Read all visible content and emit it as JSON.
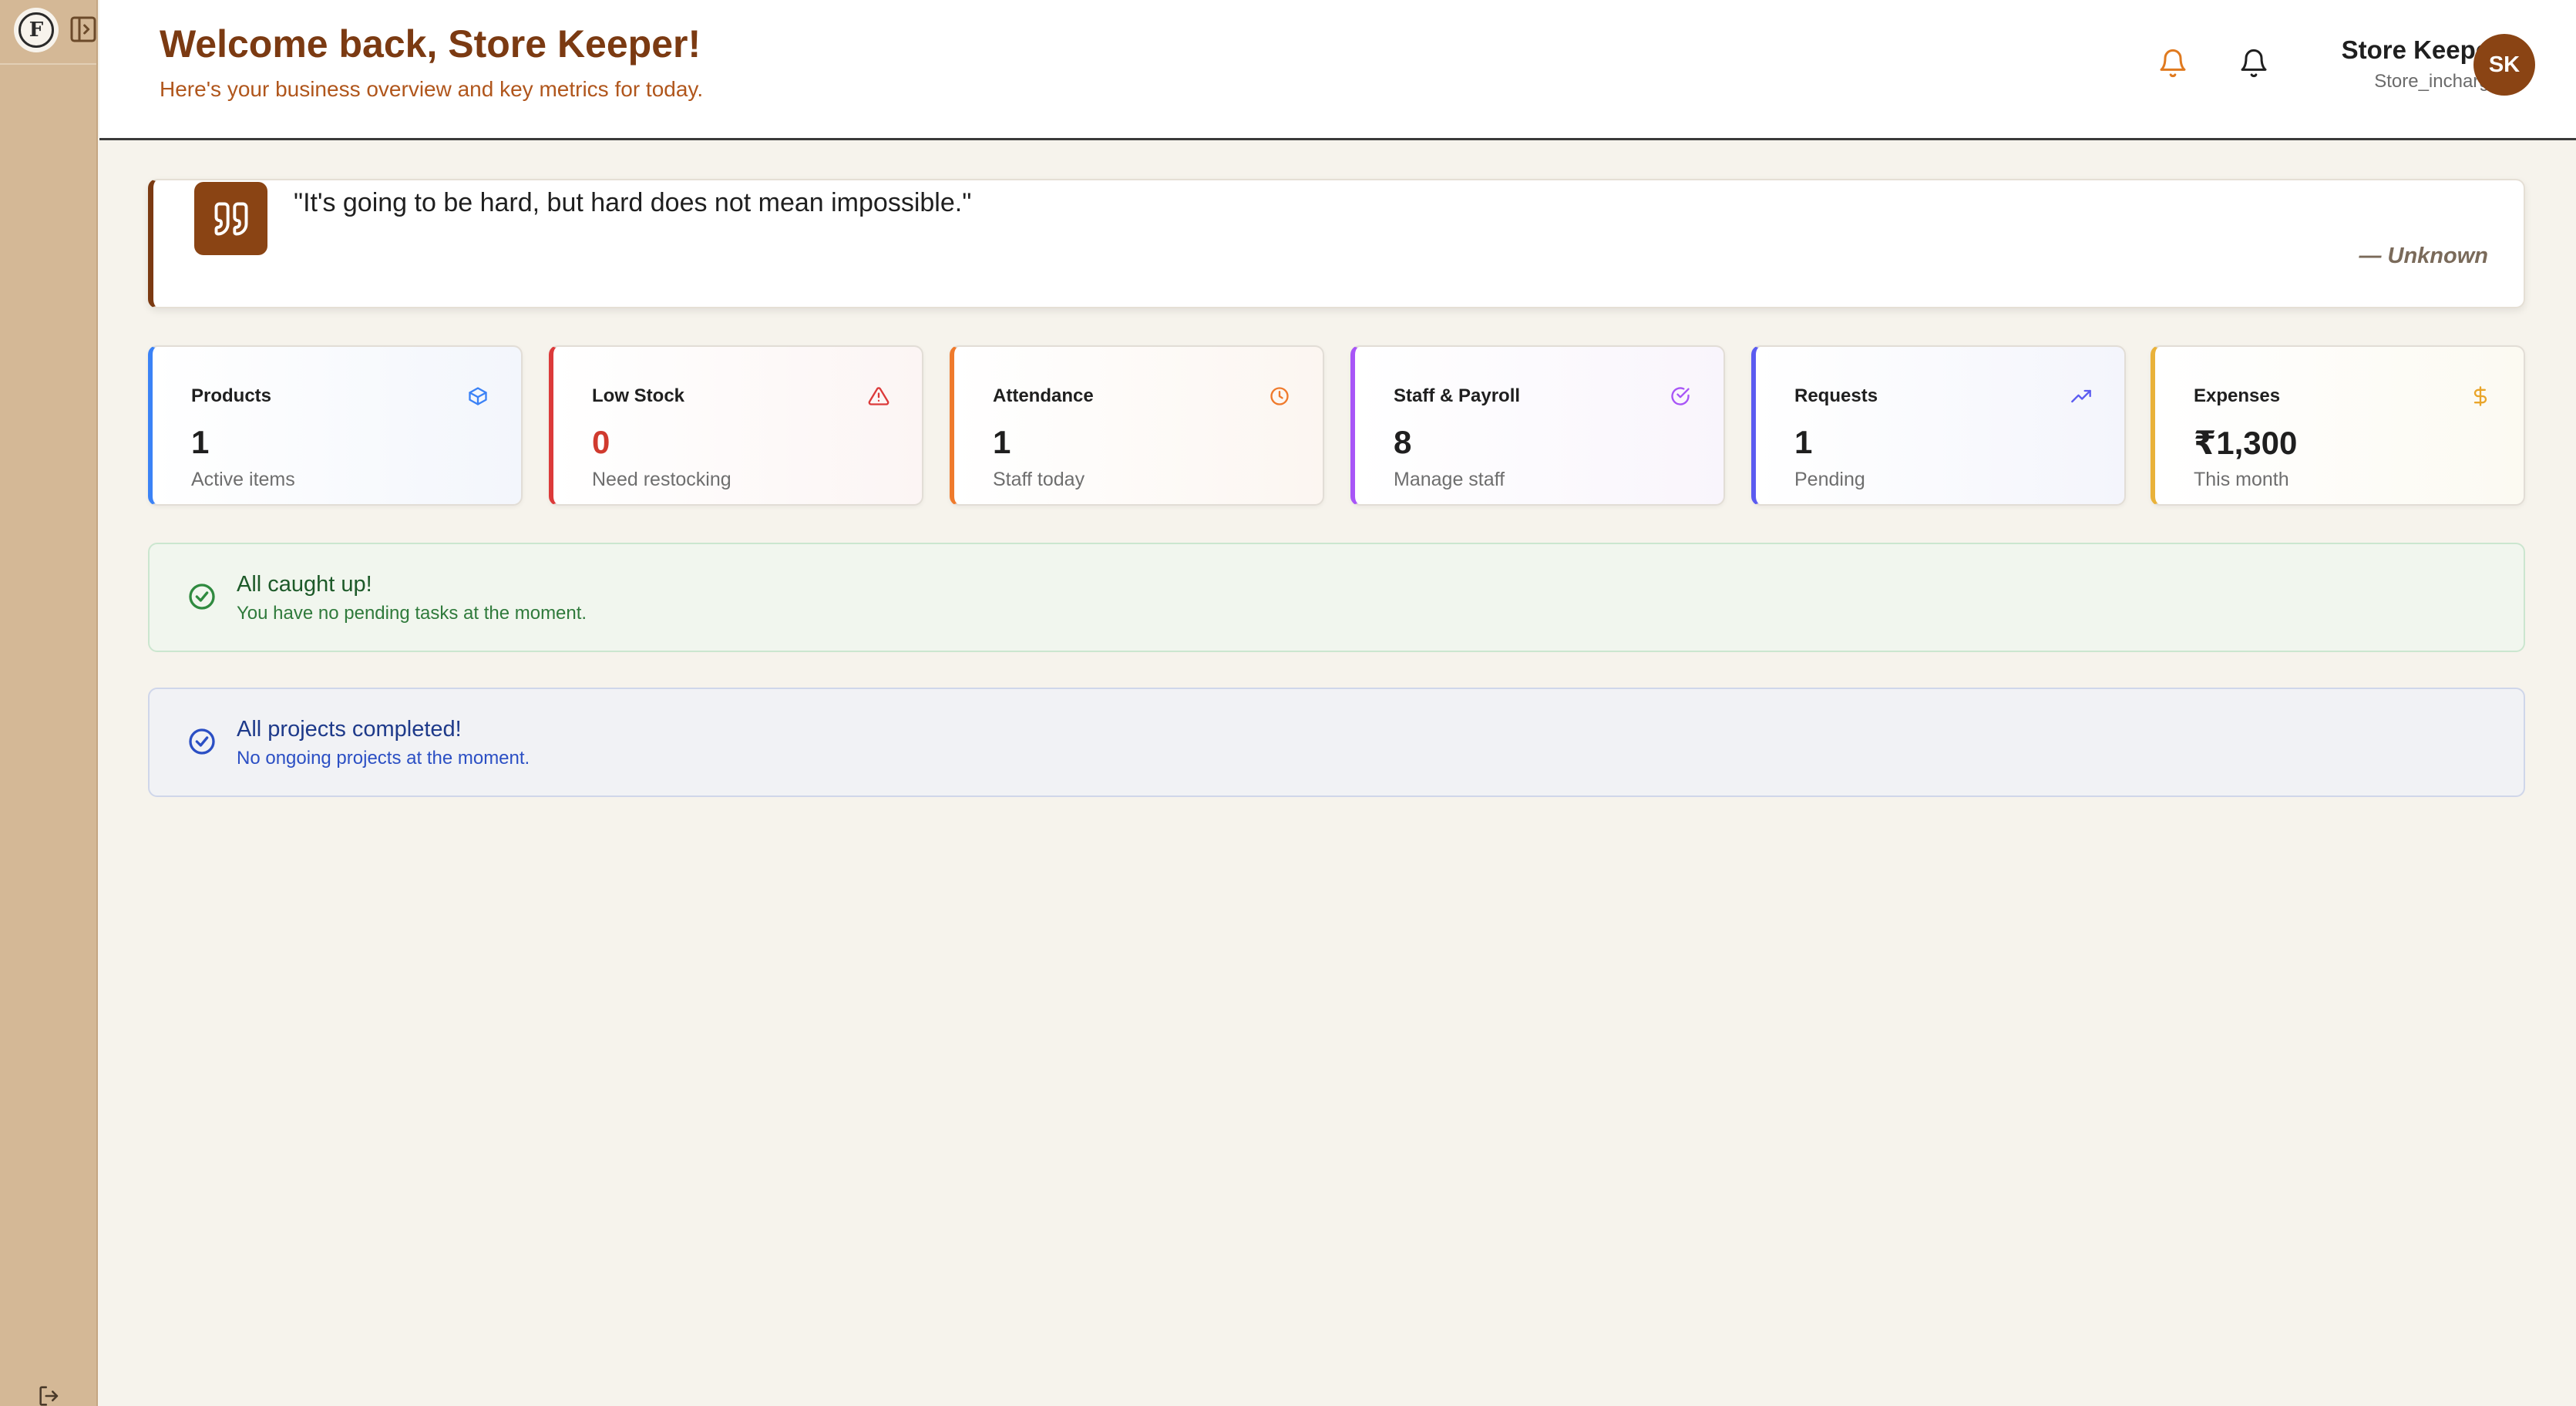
{
  "sidebar": {
    "logo_letter": "F",
    "toggle_icon": "sidebar-toggle-icon",
    "logout_icon": "logout-icon"
  },
  "header": {
    "title": "Welcome back, Store Keeper!",
    "subtitle": "Here's your business overview and key metrics for today.",
    "notification_icons": [
      "bell-icon",
      "bell-icon"
    ],
    "user": {
      "name": "Store Keeper",
      "role": "Store_incharge",
      "initials": "SK"
    }
  },
  "quote": {
    "text": "\"It's going to be hard, but hard does not mean impossible.\"",
    "author": "— Unknown",
    "icon": "quote-icon"
  },
  "stats": [
    {
      "label": "Products",
      "value": "1",
      "description": "Active items",
      "icon": "box-icon",
      "color": "#3b82f6"
    },
    {
      "label": "Low Stock",
      "value": "0",
      "description": "Need restocking",
      "icon": "warning-triangle-icon",
      "color": "#dc3a3a"
    },
    {
      "label": "Attendance",
      "value": "1",
      "description": "Staff today",
      "icon": "clock-icon",
      "color": "#ef7a2c"
    },
    {
      "label": "Staff & Payroll",
      "value": "8",
      "description": "Manage staff",
      "icon": "check-circle-icon",
      "color": "#a855f7"
    },
    {
      "label": "Requests",
      "value": "1",
      "description": "Pending",
      "icon": "trending-up-icon",
      "color": "#5b5bf0"
    },
    {
      "label": "Expenses",
      "value": "₹1,300",
      "description": "This month",
      "icon": "dollar-icon",
      "color": "#e9b23a"
    }
  ],
  "alerts": {
    "tasks": {
      "title": "All caught up!",
      "text": "You have no pending tasks at the moment.",
      "color": "#2f7a3b"
    },
    "projects": {
      "title": "All projects completed!",
      "text": "No ongoing projects at the moment.",
      "color": "#2b4fc4"
    }
  },
  "colors": {
    "brand": "#7b3a12",
    "accent": "#b0561c",
    "sidebar": "#d4b896",
    "background": "#f6f3ec"
  }
}
